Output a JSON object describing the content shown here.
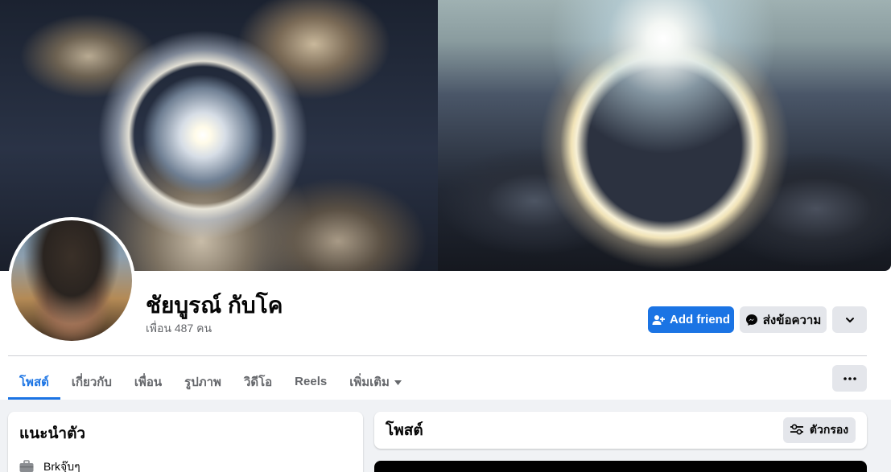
{
  "profile": {
    "name": "ชัยบูรณ์ กับโค",
    "friends": "เพื่อน 487 คน"
  },
  "actions": {
    "add_friend": "Add friend",
    "message": "ส่งข้อความ"
  },
  "tabs": [
    {
      "label": "โพสต์",
      "active": true
    },
    {
      "label": "เกี่ยวกับ"
    },
    {
      "label": "เพื่อน"
    },
    {
      "label": "รูปภาพ"
    },
    {
      "label": "วิดีโอ"
    },
    {
      "label": "Reels"
    },
    {
      "label": "เพิ่มเติม"
    }
  ],
  "intro": {
    "title": "แนะนำตัว",
    "work": "Brkจุ๊บๆ"
  },
  "posts": {
    "title": "โพสต์",
    "filter_label": "ตัวกรอง"
  },
  "colors": {
    "primary": "#1b74e4",
    "secondary_button": "#e4e6eb",
    "page_background": "#f0f2f5",
    "muted_text": "#65676b"
  },
  "icons": {
    "add_friend": "person-plus-icon",
    "message": "messenger-icon",
    "dropdown": "chevron-down-icon",
    "more": "more-horizontal-icon",
    "work": "briefcase-icon",
    "filter": "sliders-icon"
  }
}
